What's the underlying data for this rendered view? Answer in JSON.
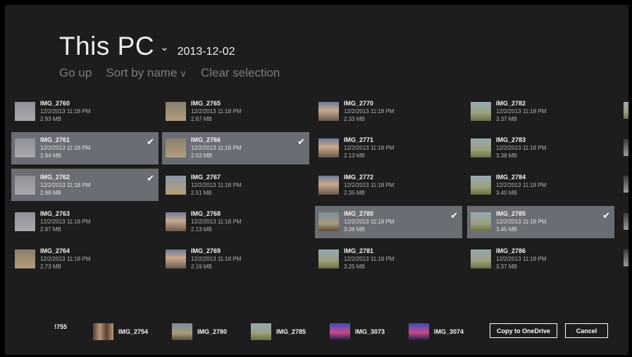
{
  "header": {
    "location": "This PC",
    "folder": "2013-12-02"
  },
  "commands": {
    "go_up": "Go up",
    "sort": "Sort by name",
    "clear": "Clear selection"
  },
  "icons": {
    "location_chevron": "chevron-down-icon",
    "checkmark": "checkmark-icon"
  },
  "colors": {
    "background": "#1d1d1d",
    "selected_tile": "#6b6d74",
    "text": "#f4f4f4"
  },
  "files": [
    {
      "name": "IMG_2760",
      "date": "12/2/2013 11:18 PM",
      "size": "2.93 MB",
      "selected": false,
      "thumb": "t-sky"
    },
    {
      "name": "IMG_2761",
      "date": "12/2/2013 11:18 PM",
      "size": "2.94 MB",
      "selected": true,
      "thumb": "t-sky"
    },
    {
      "name": "IMG_2762",
      "date": "12/2/2013 11:18 PM",
      "size": "2.98 MB",
      "selected": true,
      "thumb": "t-sky"
    },
    {
      "name": "IMG_2763",
      "date": "12/2/2013 11:18 PM",
      "size": "2.97 MB",
      "selected": false,
      "thumb": "t-sky"
    },
    {
      "name": "IMG_2764",
      "date": "12/2/2013 11:18 PM",
      "size": "2.73 MB",
      "selected": false,
      "thumb": "t-desert"
    },
    {
      "name": "IMG_2765",
      "date": "12/2/2013 11:18 PM",
      "size": "2.67 MB",
      "selected": false,
      "thumb": "t-desert"
    },
    {
      "name": "IMG_2766",
      "date": "12/2/2013 11:18 PM",
      "size": "2.63 MB",
      "selected": true,
      "thumb": "t-desert"
    },
    {
      "name": "IMG_2767",
      "date": "12/2/2013 11:18 PM",
      "size": "2.51 MB",
      "selected": false,
      "thumb": "t-haze"
    },
    {
      "name": "IMG_2768",
      "date": "12/2/2013 11:18 PM",
      "size": "2.13 MB",
      "selected": false,
      "thumb": "t-sunset"
    },
    {
      "name": "IMG_2769",
      "date": "12/2/2013 11:18 PM",
      "size": "2.19 MB",
      "selected": false,
      "thumb": "t-sunset"
    },
    {
      "name": "IMG_2770",
      "date": "12/2/2013 11:18 PM",
      "size": "2.33 MB",
      "selected": false,
      "thumb": "t-sunset"
    },
    {
      "name": "IMG_2771",
      "date": "12/2/2013 11:18 PM",
      "size": "2.13 MB",
      "selected": false,
      "thumb": "t-sunset"
    },
    {
      "name": "IMG_2772",
      "date": "12/2/2013 11:18 PM",
      "size": "2.35 MB",
      "selected": false,
      "thumb": "t-sunset"
    },
    {
      "name": "IMG_2780",
      "date": "12/2/2013 11:18 PM",
      "size": "3.08 MB",
      "selected": true,
      "thumb": "t-city"
    },
    {
      "name": "IMG_2781",
      "date": "12/2/2013 11:18 PM",
      "size": "3.25 MB",
      "selected": false,
      "thumb": "t-palm"
    },
    {
      "name": "IMG_2782",
      "date": "12/2/2013 11:18 PM",
      "size": "3.37 MB",
      "selected": false,
      "thumb": "t-palm"
    },
    {
      "name": "IMG_2783",
      "date": "12/2/2013 11:18 PM",
      "size": "3.38 MB",
      "selected": false,
      "thumb": "t-palm"
    },
    {
      "name": "IMG_2784",
      "date": "12/2/2013 11:18 PM",
      "size": "3.40 MB",
      "selected": false,
      "thumb": "t-palm"
    },
    {
      "name": "IMG_2785",
      "date": "12/2/2013 11:18 PM",
      "size": "3.45 MB",
      "selected": true,
      "thumb": "t-palm"
    },
    {
      "name": "IMG_2786",
      "date": "12/2/2013 11:18 PM",
      "size": "3.37 MB",
      "selected": false,
      "thumb": "t-palm"
    }
  ],
  "edge_thumbs": [
    "t-palm",
    "t-dark",
    "t-dark",
    "t-dark",
    "t-dark"
  ],
  "basket": [
    {
      "name": "!755",
      "thumb": ""
    },
    {
      "name": "IMG_2754",
      "thumb": "t-guitar"
    },
    {
      "name": "IMG_2780",
      "thumb": "t-city"
    },
    {
      "name": "IMG_2785",
      "thumb": "t-palm"
    },
    {
      "name": "IMG_3073",
      "thumb": "t-magenta"
    },
    {
      "name": "IMG_3074",
      "thumb": "t-magenta"
    }
  ],
  "buttons": {
    "copy": "Copy to OneDrive",
    "cancel": "Cancel"
  }
}
